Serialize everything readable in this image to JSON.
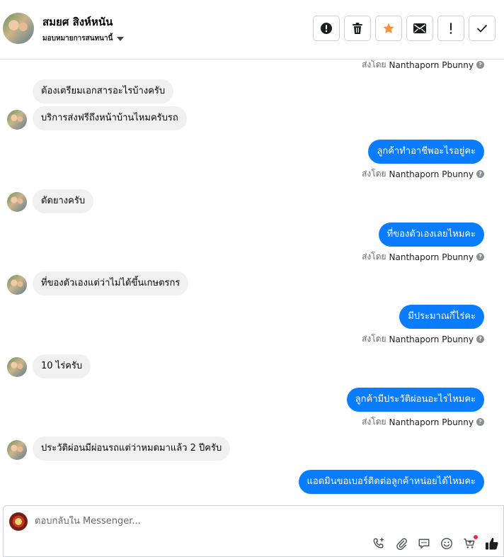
{
  "header": {
    "contact_name": "สมยศ สิงห์หนัน",
    "assign_label": "มอบหมายการสนทนานี้"
  },
  "toolbar": {
    "buttons": [
      {
        "icon": "alert-circle-icon"
      },
      {
        "icon": "trash-icon"
      },
      {
        "icon": "star-icon",
        "color": "#f7923a"
      },
      {
        "icon": "envelope-icon"
      },
      {
        "icon": "exclamation-icon"
      },
      {
        "icon": "check-icon"
      }
    ]
  },
  "sent_by_prefix": "ส่งโดย",
  "sender_name": "Nanthaporn Pbunny",
  "help_glyph": "?",
  "messages": [
    {
      "direction": "outgoing-meta-only"
    },
    {
      "direction": "incoming",
      "text": "ต้องเตรียมเอกสารอะไรบ้างครับ"
    },
    {
      "direction": "incoming",
      "text": "บริการส่งฟรีถึงหน้าบ้านไหมครับรถ"
    },
    {
      "direction": "outgoing",
      "text": "ลูกค้าทำอาชีพอะไรอยู่คะ"
    },
    {
      "direction": "incoming",
      "text": "ตัดยางครับ"
    },
    {
      "direction": "outgoing",
      "text": "ที่ของตัวเองเลยไหมคะ"
    },
    {
      "direction": "incoming",
      "text": "ที่ของตัวเองแต่ว่าไม่ได้ขึ้นเกษตรกร"
    },
    {
      "direction": "outgoing",
      "text": "มีประมาณกี่ไร่คะ"
    },
    {
      "direction": "incoming",
      "text": "10 ไร่ครับ"
    },
    {
      "direction": "outgoing",
      "text": "ลูกค้ามีประวัติผ่อนอะไรไหมคะ"
    },
    {
      "direction": "incoming",
      "text": "ประวัติผ่อนมีผ่อนรถแต่ว่าหมดมาแล้ว 2 ปีครับ"
    },
    {
      "direction": "outgoing",
      "text": "แอดมินขอเบอร์ติดต่อลูกค้าหน่อยได้ไหมคะ"
    }
  ],
  "composer": {
    "placeholder": "ตอบกลับใน Messenger...",
    "tools": [
      "phone-add-icon",
      "paperclip-icon",
      "saved-reply-icon",
      "emoji-icon",
      "cart-icon",
      "like-icon"
    ]
  },
  "colors": {
    "outgoing_bubble": "#0a7cff",
    "incoming_bubble": "#f0f0f0",
    "notification_dot": "#f02849"
  }
}
